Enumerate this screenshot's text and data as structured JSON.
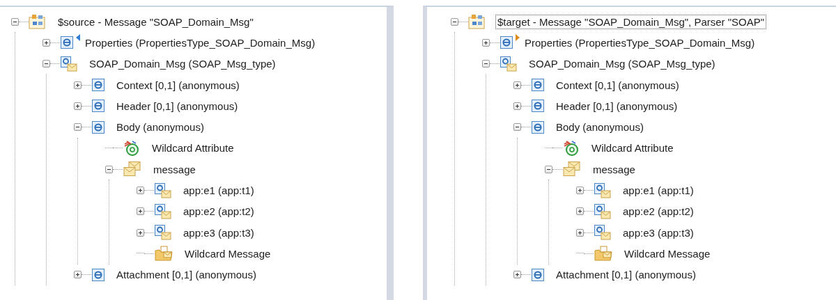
{
  "panes": [
    {
      "root": {
        "label": "$source - Message \"SOAP_Domain_Msg\"",
        "kind": "root",
        "focused": false,
        "expanded": true,
        "children": [
          {
            "label": "Properties (PropertiesType_SOAP_Domain_Msg)",
            "kind": "element",
            "expanded": false,
            "marker": {
              "color": "#2f7fd6",
              "kind": "left"
            }
          },
          {
            "label": "SOAP_Domain_Msg (SOAP_Msg_type)",
            "kind": "message-element",
            "expanded": true,
            "children": [
              {
                "label": "Context [0,1] (anonymous)",
                "kind": "element",
                "expanded": false
              },
              {
                "label": "Header [0,1] (anonymous)",
                "kind": "element",
                "expanded": false
              },
              {
                "label": "Body (anonymous)",
                "kind": "element",
                "expanded": true,
                "children": [
                  {
                    "label": "Wildcard Attribute",
                    "kind": "wildcard-attribute"
                  },
                  {
                    "label": "message",
                    "kind": "message-group",
                    "expanded": true,
                    "children": [
                      {
                        "label": "app:e1 (app:t1)",
                        "kind": "message-element",
                        "expanded": false
                      },
                      {
                        "label": "app:e2 (app:t2)",
                        "kind": "message-element",
                        "expanded": false
                      },
                      {
                        "label": "app:e3 (app:t3)",
                        "kind": "message-element",
                        "expanded": false
                      },
                      {
                        "label": "Wildcard Message",
                        "kind": "wildcard-message"
                      }
                    ]
                  }
                ]
              },
              {
                "label": "Attachment [0,1] (anonymous)",
                "kind": "element",
                "expanded": false
              }
            ]
          }
        ]
      }
    },
    {
      "root": {
        "label": "$target - Message \"SOAP_Domain_Msg\", Parser \"SOAP\"",
        "kind": "root",
        "focused": true,
        "expanded": true,
        "children": [
          {
            "label": "Properties (PropertiesType_SOAP_Domain_Msg)",
            "kind": "element",
            "expanded": false,
            "marker": {
              "color": "#e08a1e",
              "kind": "right"
            }
          },
          {
            "label": "SOAP_Domain_Msg (SOAP_Msg_type)",
            "kind": "message-element",
            "expanded": true,
            "children": [
              {
                "label": "Context [0,1] (anonymous)",
                "kind": "element",
                "expanded": false
              },
              {
                "label": "Header [0,1] (anonymous)",
                "kind": "element",
                "expanded": false
              },
              {
                "label": "Body (anonymous)",
                "kind": "element",
                "expanded": true,
                "children": [
                  {
                    "label": "Wildcard Attribute",
                    "kind": "wildcard-attribute"
                  },
                  {
                    "label": "message",
                    "kind": "message-group",
                    "expanded": true,
                    "children": [
                      {
                        "label": "app:e1 (app:t1)",
                        "kind": "message-element",
                        "expanded": false
                      },
                      {
                        "label": "app:e2 (app:t2)",
                        "kind": "message-element",
                        "expanded": false
                      },
                      {
                        "label": "app:e3 (app:t3)",
                        "kind": "message-element",
                        "expanded": false
                      },
                      {
                        "label": "Wildcard Message",
                        "kind": "wildcard-message"
                      }
                    ]
                  }
                ]
              },
              {
                "label": "Attachment [0,1] (anonymous)",
                "kind": "element",
                "expanded": false
              }
            ]
          }
        ]
      }
    }
  ]
}
